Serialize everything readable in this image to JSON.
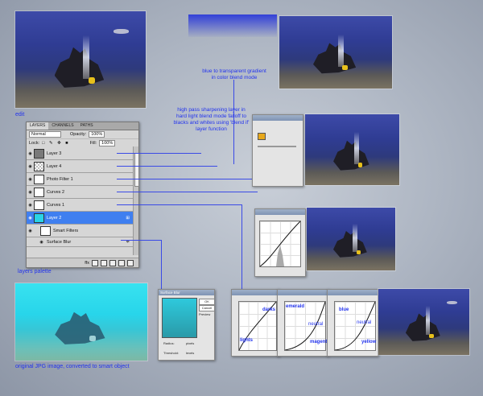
{
  "captions": {
    "edit": "edit",
    "layers_palette": "layers palette",
    "original": "original JPG image, converted to smart object",
    "annotation_gradient": "blue to transparent gradient in color blend mode",
    "annotation_highpass": "high pass sharpening layer in hard light blend mode falloff to blacks and whites using 'blend if' layer function"
  },
  "layers_panel": {
    "tabs": [
      "LAYERS",
      "CHANNELS",
      "PATHS"
    ],
    "blend_mode": "Normal",
    "opacity_label": "Opacity:",
    "opacity_value": "100%",
    "lock_label": "Lock:",
    "fill_label": "Fill:",
    "fill_value": "100%",
    "layers": [
      {
        "name": "Layer 3"
      },
      {
        "name": "Layer 4"
      },
      {
        "name": "Photo Filter 1"
      },
      {
        "name": "Curves 2"
      },
      {
        "name": "Curves 1"
      },
      {
        "name": "Layer 2"
      },
      {
        "name": "Smart Filters"
      },
      {
        "name": "Surface Blur"
      }
    ],
    "footer_left": "ffx"
  },
  "curve_labels": {
    "darks": "darks",
    "lights": "lights",
    "emerald": "emerald",
    "neutral": "neutral",
    "magenta": "magenta",
    "blue": "blue",
    "yellow": "yellow"
  },
  "surface_blur": {
    "title": "Surface Blur",
    "ok": "OK",
    "cancel": "Cancel",
    "preview": "Preview",
    "radius_label": "Radius:",
    "radius_unit": "pixels",
    "threshold_label": "Threshold:",
    "threshold_unit": "levels"
  },
  "colors": {
    "annotation": "#2233ee",
    "selected_layer": "#3f7ff0",
    "photo_blue": "#2f3c93",
    "photo_teal": "#28d5ea",
    "photo_filter_swatch": "#e7a81b"
  }
}
